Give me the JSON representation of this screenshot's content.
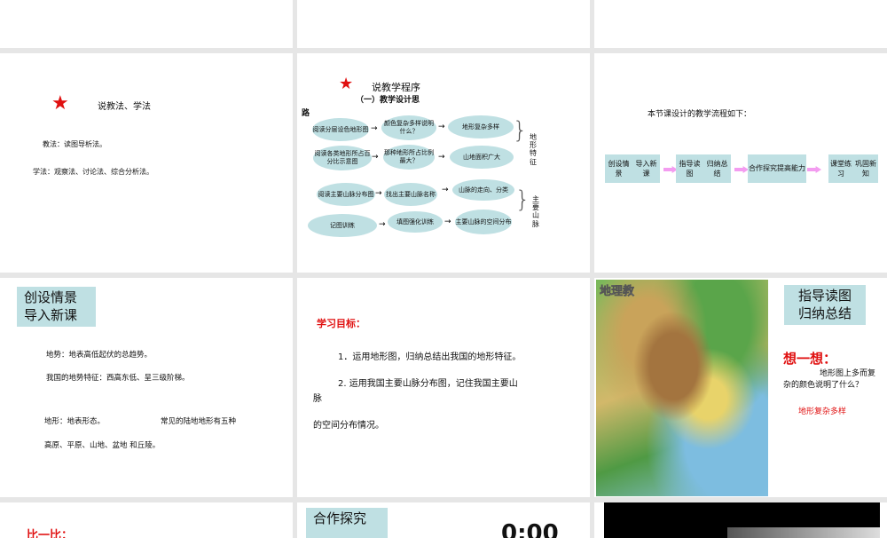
{
  "slides": {
    "s4": {
      "title": "说教法、学法",
      "line1": "教法：读图导析法。",
      "line2": "学法：观察法、讨论法、综合分析法。"
    },
    "s5": {
      "title": "说教学程序",
      "subtitle": "（一）教学设计思",
      "subtitle2": "路",
      "row1": [
        "阅读分层设色地形图",
        "颜色复杂多样说明什么？",
        "地形复杂多样"
      ],
      "row2": [
        "阅读各类地形所占百分比示意图",
        "那种地形所占比例最大？",
        "山地面积广大"
      ],
      "row3": [
        "阅读主要山脉分布图",
        "找出主要山脉名称",
        "山脉的走向、分类"
      ],
      "row4": [
        "记图训练",
        "填图强化训练",
        "主要山脉的空间分布"
      ],
      "group1": "地形特征",
      "group2": "主要山脉"
    },
    "s6": {
      "title": "本节课设计的教学流程如下：",
      "steps": [
        [
          "创设情景",
          "导入新课"
        ],
        [
          "指导读图",
          "归纳总结"
        ],
        [
          "合作探究",
          "提高能力"
        ],
        [
          "课堂练习",
          "巩固新知"
        ]
      ]
    },
    "s7": {
      "box": [
        "创设情景",
        "导入新课"
      ],
      "l1": "地势：地表高低起伏的总趋势。",
      "l2": "我国的地势特征：西高东低、呈三级阶梯。",
      "l3a": "地形：地表形态。",
      "l3b": "常见的陆地地形有五种",
      "l4": "高原、平原、山地、盆地  和丘陵。"
    },
    "s8": {
      "heading": "学习目标：",
      "g1": "1．运用地形图，归纳总结出我国的地形特征。",
      "g2": "2. 运用我国主要山脉分布图，记住我国主要山",
      "g2b": "脉",
      "g3": "的空间分布情况。"
    },
    "s9": {
      "map_label": "地理教",
      "box": [
        "指导读图",
        "归纳总结"
      ],
      "think": "想一想：",
      "q1": "地形图上多而复",
      "q2": "杂的颜色说明了什么？",
      "answer": "地形复杂多样"
    },
    "s10": {
      "heading": "比一比："
    },
    "s11": {
      "box": "合作探究",
      "timer": "0:00"
    }
  }
}
